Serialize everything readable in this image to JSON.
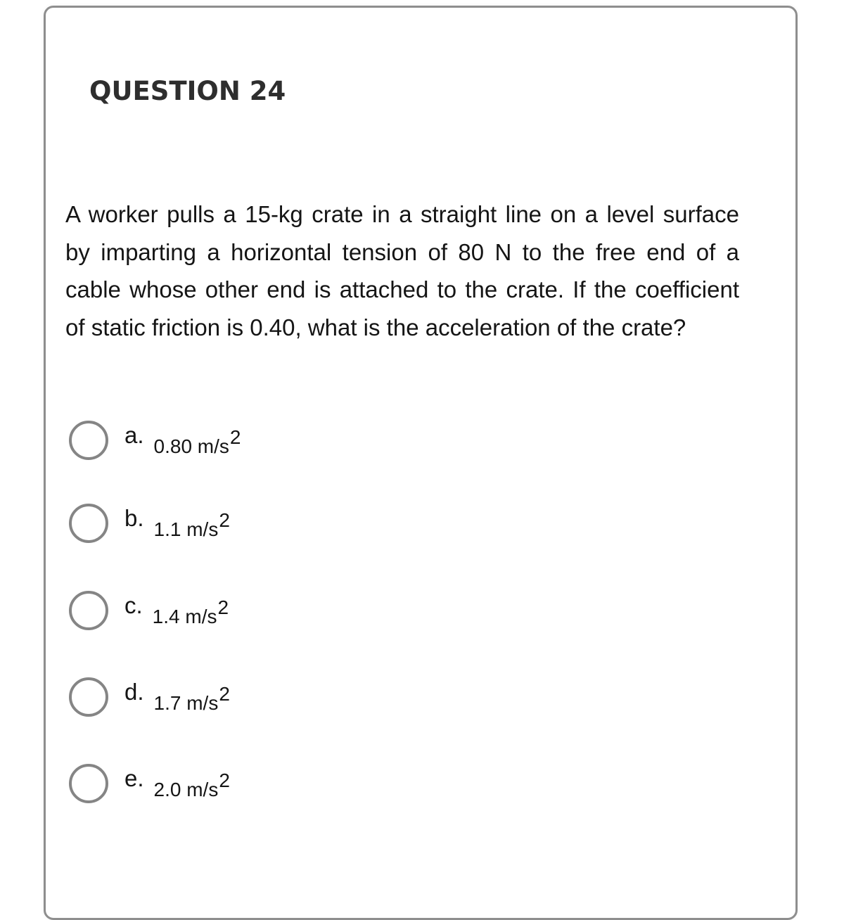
{
  "question": {
    "title": "QUESTION 24",
    "text": "A worker pulls a 15-kg crate in a straight line on a level surface by imparting a horizontal tension of 80 N to the free end of a cable whose other end is attached to the crate. If the coefficient of static friction is 0.40, what is the acceleration of the crate?"
  },
  "options": [
    {
      "letter": "a.",
      "value": "0.80 m/s",
      "exponent": "2",
      "selected": false
    },
    {
      "letter": "b.",
      "value": "1.1 m/s",
      "exponent": "2",
      "selected": false
    },
    {
      "letter": "c.",
      "value": "1.4 m/s",
      "exponent": "2",
      "selected": false
    },
    {
      "letter": "d.",
      "value": "1.7 m/s",
      "exponent": "2",
      "selected": false
    },
    {
      "letter": "e.",
      "value": "2.0 m/s",
      "exponent": "2",
      "selected": false
    }
  ],
  "colors": {
    "border": "#8e8e8e",
    "radio_border": "#858585",
    "title_text": "#2e2e2e",
    "body_text": "#151515"
  }
}
